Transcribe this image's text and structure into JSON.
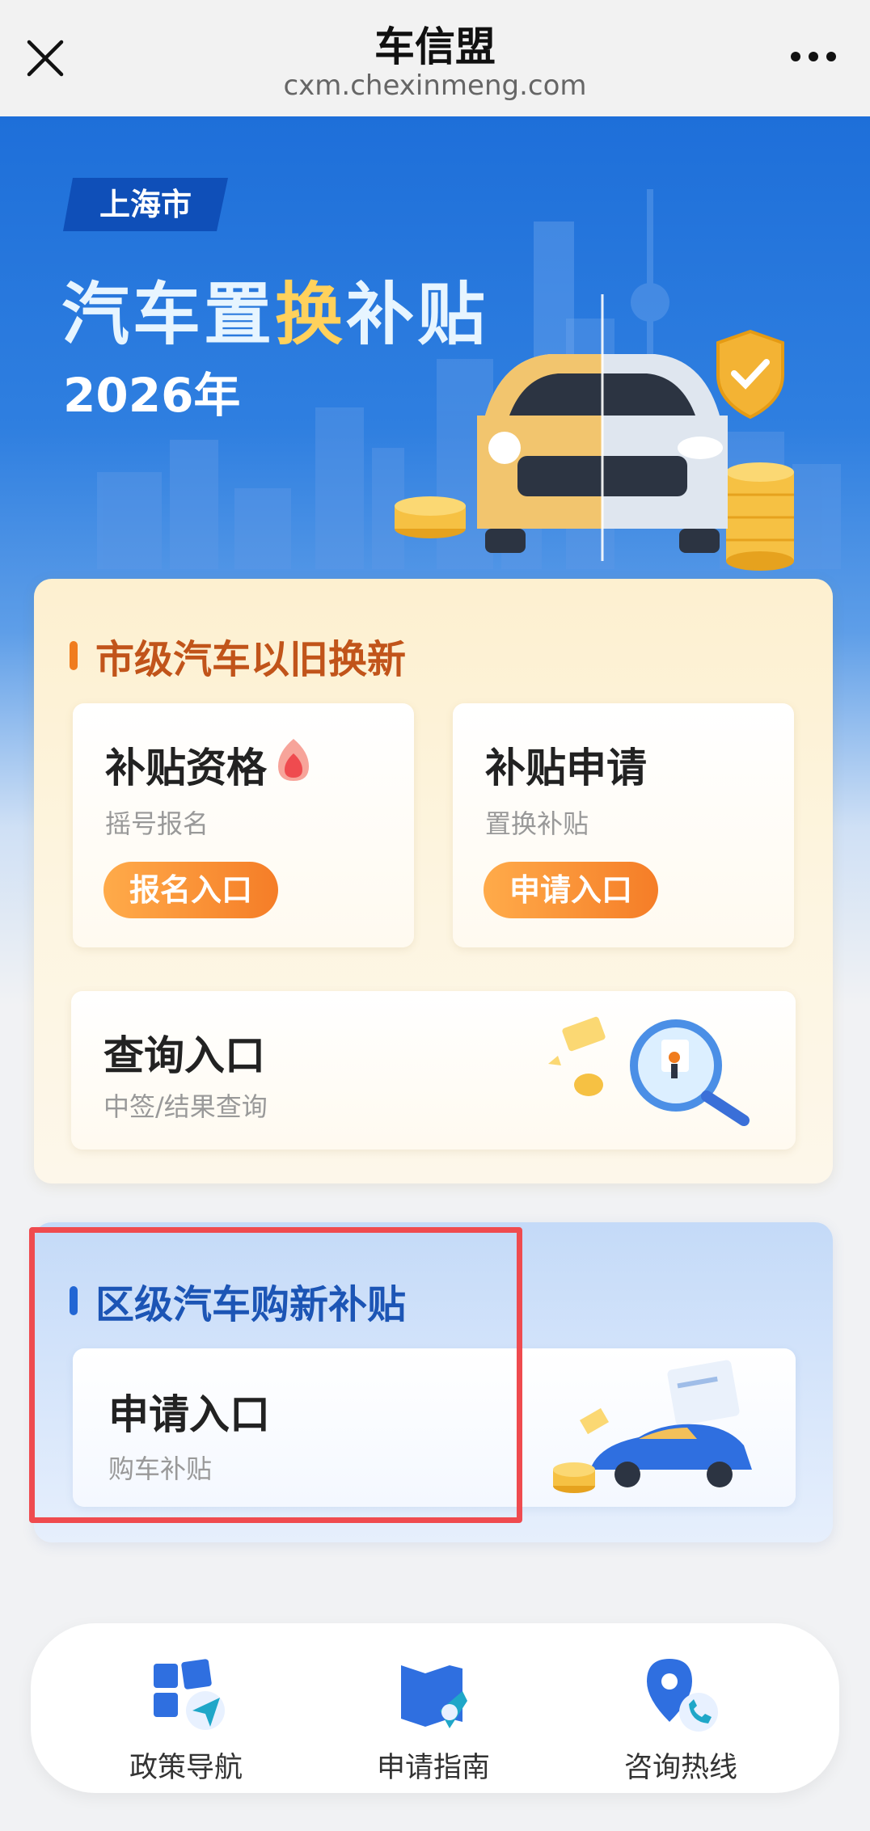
{
  "topbar": {
    "title": "车信盟",
    "url": "cxm.chexinmeng.com"
  },
  "hero": {
    "city_tag": "上海市",
    "title_part1": "汽车置",
    "title_accent": "换",
    "title_part2": "补贴",
    "year": "2026年"
  },
  "city_section": {
    "heading": "市级汽车以旧换新",
    "tiles": [
      {
        "title": "补贴资格",
        "subtitle": "摇号报名",
        "button": "报名入口"
      },
      {
        "title": "补贴申请",
        "subtitle": "置换补贴",
        "button": "申请入口"
      }
    ],
    "query": {
      "title": "查询入口",
      "subtitle": "中签/结果查询"
    }
  },
  "district_section": {
    "heading": "区级汽车购新补贴",
    "apply": {
      "title": "申请入口",
      "subtitle": "购车补贴"
    }
  },
  "bottom_nav": {
    "items": [
      {
        "label": "政策导航",
        "icon": "policy-navigation-icon"
      },
      {
        "label": "申请指南",
        "icon": "guide-book-icon"
      },
      {
        "label": "咨询热线",
        "icon": "hotline-phone-icon"
      }
    ]
  },
  "colors": {
    "brand_blue": "#1e6fd9",
    "accent_orange": "#f57d27",
    "highlight_red": "#ef4b4f"
  }
}
